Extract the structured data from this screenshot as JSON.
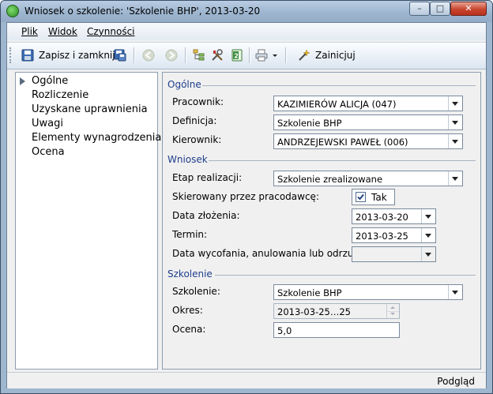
{
  "window": {
    "title": "Wniosek o szkolenie: 'Szkolenie BHP', 2013-03-20",
    "minimize_glyph": "–",
    "maximize_glyph": "□",
    "close_glyph": "✕"
  },
  "menu": {
    "items": [
      "Plik",
      "Widok",
      "Czynności"
    ]
  },
  "toolbar": {
    "save_close_label": "Zapisz i zamknij",
    "initiate_label": "Zainicjuj",
    "icons": [
      "save-icon",
      "save-as-icon",
      "back-icon",
      "forward-icon",
      "tree-icon",
      "tools-icon",
      "excel-icon",
      "print-icon",
      "dropdown-icon",
      "wand-icon"
    ]
  },
  "navigation": {
    "items": [
      "Ogólne",
      "Rozliczenie",
      "Uzyskane uprawnienia",
      "Uwagi",
      "Elementy wynagrodzenia",
      "Ocena"
    ],
    "selected": "Ogólne"
  },
  "sections": {
    "ogolne": {
      "header": "Ogólne",
      "pracownik_label": "Pracownik:",
      "pracownik_value": "KAZIMIERÓW ALICJA (047)",
      "definicja_label": "Definicja:",
      "definicja_value": "Szkolenie BHP",
      "kierownik_label": "Kierownik:",
      "kierownik_value": "ANDRZEJEWSKI PAWEŁ (006)"
    },
    "wniosek": {
      "header": "Wniosek",
      "etap_label": "Etap realizacji:",
      "etap_value": "Szkolenie zrealizowane",
      "skierowany_label": "Skierowany przez pracodawcę:",
      "skierowany_checked": true,
      "skierowany_value": "Tak",
      "data_zlozenia_label": "Data złożenia:",
      "data_zlozenia_value": "2013-03-20",
      "termin_label": "Termin:",
      "termin_value": "2013-03-25",
      "data_wycofania_label": "Data wycofania, anulowania lub odrzucenia:",
      "data_wycofania_value": ""
    },
    "szkolenie": {
      "header": "Szkolenie",
      "szkolenie_label": "Szkolenie:",
      "szkolenie_value": "Szkolenie BHP",
      "okres_label": "Okres:",
      "okres_value": "2013-03-25…25",
      "ocena_label": "Ocena:",
      "ocena_value": "5,0"
    }
  },
  "status": {
    "right_text": "Podgląd"
  }
}
